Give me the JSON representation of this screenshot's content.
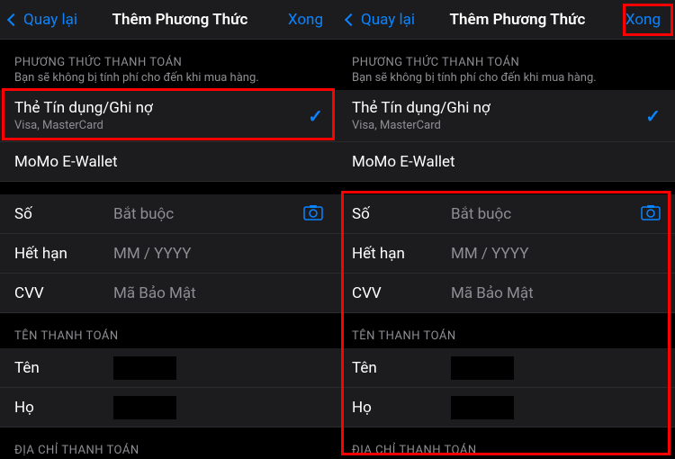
{
  "colors": {
    "accent": "#0a84ff",
    "highlight": "#ff0000"
  },
  "nav": {
    "back": "Quay lại",
    "title": "Thêm Phương Thức",
    "done": "Xong"
  },
  "payment_method": {
    "header": "PHƯƠNG THỨC THANH TOÁN",
    "note": "Bạn sẽ không bị tính phí cho đến khi mua hàng.",
    "options": [
      {
        "title": "Thẻ Tín dụng/Ghi nợ",
        "subtitle": "Visa, MasterCard",
        "selected": true
      },
      {
        "title": "MoMo E-Wallet",
        "subtitle": "",
        "selected": false
      }
    ]
  },
  "card_form": {
    "rows": [
      {
        "label": "Số",
        "placeholder": "Bắt buộc",
        "has_camera": true
      },
      {
        "label": "Hết hạn",
        "placeholder": "MM / YYYY",
        "has_camera": false
      },
      {
        "label": "CVV",
        "placeholder": "Mã Bảo Mật",
        "has_camera": false
      }
    ]
  },
  "billing_name": {
    "header": "TÊN THANH TOÁN",
    "rows": [
      {
        "label": "Tên"
      },
      {
        "label": "Họ"
      }
    ]
  },
  "billing_address": {
    "header": "ĐỊA CHỈ THANH TOÁN"
  },
  "icons": {
    "camera": "camera-icon",
    "checkmark": "checkmark-icon",
    "chevron_left": "chevron-left-icon"
  }
}
